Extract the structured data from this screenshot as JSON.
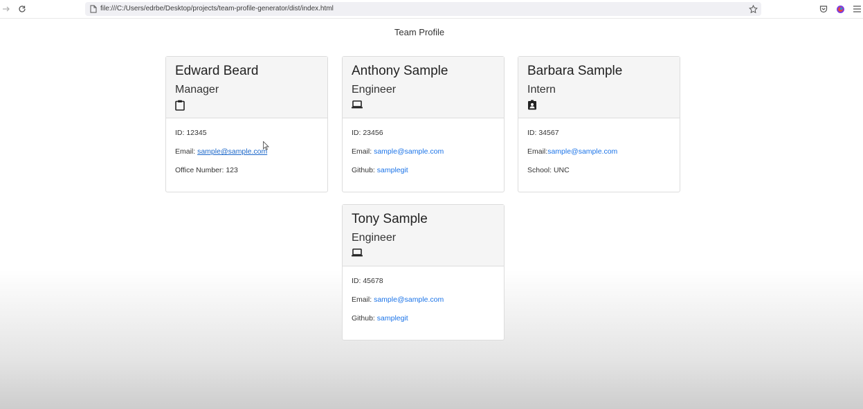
{
  "browser": {
    "url": "file:///C:/Users/edrbe/Desktop/projects/team-profile-generator/dist/index.html"
  },
  "page": {
    "title": "Team Profile"
  },
  "cards": [
    {
      "name": "Edward Beard",
      "role": "Manager",
      "icon": "clipboard-icon",
      "id_text": "ID: 12345",
      "email_label": "Email: ",
      "email": "sample@sample.com",
      "extra_label": "Office Number: 123",
      "extra_link": ""
    },
    {
      "name": "Anthony Sample",
      "role": "Engineer",
      "icon": "laptop-icon",
      "id_text": "ID: 23456",
      "email_label": "Email: ",
      "email": "sample@sample.com",
      "extra_label": "Github: ",
      "extra_link": "samplegit"
    },
    {
      "name": "Barbara Sample",
      "role": "Intern",
      "icon": "id-badge-icon",
      "id_text": "ID: 34567",
      "email_label": "Email:",
      "email": "sample@sample.com",
      "extra_label": "School: UNC",
      "extra_link": ""
    },
    {
      "name": "Tony Sample",
      "role": "Engineer",
      "icon": "laptop-icon",
      "id_text": "ID: 45678",
      "email_label": "Email: ",
      "email": "sample@sample.com",
      "extra_label": "Github: ",
      "extra_link": "samplegit"
    }
  ],
  "colors": {
    "link": "#1a73e8",
    "card_header_bg": "#f5f5f5",
    "card_border": "#dcdcdc"
  }
}
